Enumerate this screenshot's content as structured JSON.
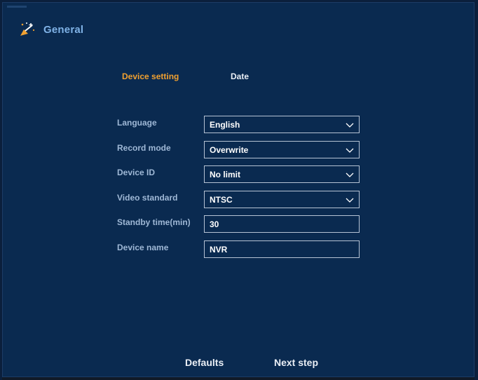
{
  "header": {
    "title": "General",
    "icon": "wizard-wand-icon"
  },
  "tabs": [
    {
      "label": "Device setting",
      "active": true
    },
    {
      "label": "Date",
      "active": false
    }
  ],
  "form": {
    "language": {
      "label": "Language",
      "value": "English"
    },
    "record_mode": {
      "label": "Record mode",
      "value": "Overwrite"
    },
    "device_id": {
      "label": "Device ID",
      "value": "No limit"
    },
    "video_standard": {
      "label": "Video standard",
      "value": "NTSC"
    },
    "standby_time": {
      "label": "Standby time(min)",
      "value": "30"
    },
    "device_name": {
      "label": "Device name",
      "value": "NVR"
    }
  },
  "footer": {
    "defaults_label": "Defaults",
    "next_label": "Next step"
  },
  "colors": {
    "background": "#0a2a50",
    "accent_active_tab": "#f0a030",
    "title": "#7fb2e6",
    "label": "#9fb8d6",
    "field_border": "#b6c3d4"
  }
}
